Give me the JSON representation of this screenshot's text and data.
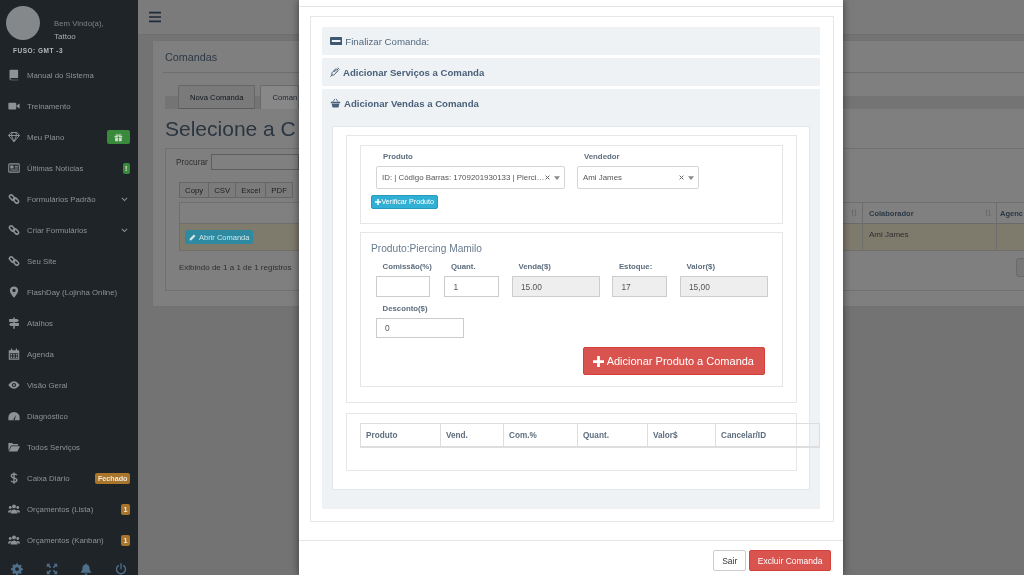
{
  "sidebar": {
    "greeting": "Bem Vindo(a),",
    "user_name": "Tattoo",
    "timezone": "FUSO: GMT -3",
    "items": [
      {
        "label": "Manual do Sistema",
        "has_submenu": false
      },
      {
        "label": "Treinamento",
        "has_submenu": false
      },
      {
        "label": "Meu Plano",
        "has_submenu": false,
        "badge": {
          "kind": "icon",
          "color": "#3a8a3c"
        }
      },
      {
        "label": "Últimas Notícias",
        "has_submenu": false,
        "badge": {
          "kind": "text",
          "text": "!",
          "color": "#3a8a3c"
        }
      },
      {
        "label": "Formulários Padrão",
        "has_submenu": true
      },
      {
        "label": "Criar Formulários",
        "has_submenu": true
      },
      {
        "label": "Seu Site",
        "has_submenu": false
      },
      {
        "label": "FlashDay (Lojinha Online)",
        "has_submenu": false
      },
      {
        "label": "Atalhos",
        "has_submenu": false
      },
      {
        "label": "Agenda",
        "has_submenu": false
      },
      {
        "label": "Visão Geral",
        "has_submenu": false
      },
      {
        "label": "Diagnóstico",
        "has_submenu": false
      },
      {
        "label": "Todos Serviços",
        "has_submenu": false
      },
      {
        "label": "Caixa Diário",
        "has_submenu": false,
        "badge": {
          "kind": "text",
          "text": "Fechado",
          "color": "#a8752b"
        }
      },
      {
        "label": "Orçamentos (Lista)",
        "has_submenu": false,
        "badge": {
          "kind": "text",
          "text": "1",
          "color": "#a8752b"
        }
      },
      {
        "label": "Orçamentos (Kanban)",
        "has_submenu": false,
        "badge": {
          "kind": "text",
          "text": "1",
          "color": "#a8752b"
        }
      }
    ]
  },
  "page": {
    "title": "Comandas",
    "tabs": [
      {
        "label": "Nova Comanda",
        "selected": false
      },
      {
        "label": "Coman",
        "selected": true
      }
    ],
    "heading": "Selecione a C",
    "search_label": "Procurar",
    "export_buttons": [
      "Copy",
      "CSV",
      "Excel",
      "PDF"
    ],
    "table": {
      "columns": [
        "Colaborador",
        "Agenc"
      ],
      "rows": [
        {
          "highlighted": true,
          "action": "Abrir Comanda",
          "cells": [
            "Ami James"
          ]
        }
      ]
    },
    "info": "Exibindo de 1 a 1 de 1 registros"
  },
  "modal": {
    "sections": [
      {
        "kind": "header",
        "title": "Finalizar Comanda:",
        "expanded": false
      },
      {
        "kind": "toggle",
        "title": "Adicionar Serviços a Comanda",
        "expanded": false
      },
      {
        "kind": "toggle",
        "title": "Adicionar Vendas a Comanda",
        "expanded": true,
        "body": {
          "selection": {
            "fields": [
              {
                "label": "Produto",
                "value": "ID: | Código Barras: 1709201930133 | Pierci…"
              },
              {
                "label": "Vendedor",
                "value": "Ami James"
              }
            ],
            "verify_button": "Verificar Produto"
          },
          "product": {
            "title": "Produto:Piercing Mamilo",
            "field_rows": [
              [
                {
                  "label": "Comissão(%)",
                  "disabled": false
                },
                {
                  "label": "Quant.",
                  "value": "1",
                  "disabled": false
                },
                {
                  "label": "Venda($)",
                  "value": "15.00",
                  "disabled": true
                },
                {
                  "label": "Estoque:",
                  "value": "17",
                  "disabled": true
                },
                {
                  "label": "Valor($)",
                  "value": "15,00",
                  "disabled": true
                }
              ],
              [
                {
                  "label": "Desconto($)",
                  "value": "0",
                  "disabled": false
                }
              ]
            ],
            "add_button": "Adicionar Produto a Comanda"
          },
          "items_table": {
            "columns": [
              "Produto",
              "Vend.",
              "Com.%",
              "Quant.",
              "Valor$",
              "Cancelar/ID"
            ]
          }
        }
      }
    ],
    "footer_buttons": [
      {
        "label": "Sair",
        "kind": "default"
      },
      {
        "label": "Excluir Comanda",
        "kind": "danger"
      }
    ]
  }
}
